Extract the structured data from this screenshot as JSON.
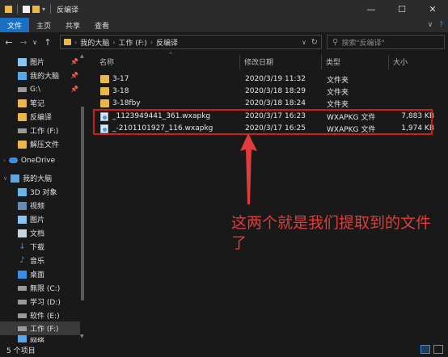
{
  "titlebar": {
    "title": "反编译",
    "minimize": "—",
    "maximize": "☐",
    "close": "✕"
  },
  "ribbon": {
    "tabs": [
      "文件",
      "主页",
      "共享",
      "查看"
    ],
    "expand": "∨",
    "help": "?"
  },
  "address": {
    "crumbs": [
      "我的大脑",
      "工作 (F:)",
      "反编译"
    ],
    "search_placeholder": "搜索\"反编译\""
  },
  "sidebar": {
    "items": [
      {
        "label": "图片",
        "icon": "pictures-icon",
        "pinned": true
      },
      {
        "label": "我的大脑",
        "icon": "computer-icon",
        "pinned": true
      },
      {
        "label": "G:\\",
        "icon": "drive-icon",
        "pinned": true
      },
      {
        "label": "笔记",
        "icon": "folder-icon",
        "pinned": false
      },
      {
        "label": "反编译",
        "icon": "folder-icon",
        "pinned": false
      },
      {
        "label": "工作 (F:)",
        "icon": "drive-icon",
        "pinned": false
      },
      {
        "label": "解压文件",
        "icon": "folder-icon",
        "pinned": false
      },
      {
        "label": "OneDrive",
        "icon": "cloud-icon",
        "pinned": false
      },
      {
        "label": "我的大脑",
        "icon": "computer-icon",
        "pinned": false
      },
      {
        "label": "3D 对象",
        "icon": "3d-objects-icon",
        "pinned": false
      },
      {
        "label": "视频",
        "icon": "video-icon",
        "pinned": false
      },
      {
        "label": "图片",
        "icon": "pictures-icon",
        "pinned": false
      },
      {
        "label": "文档",
        "icon": "documents-icon",
        "pinned": false
      },
      {
        "label": "下载",
        "icon": "download-icon",
        "pinned": false
      },
      {
        "label": "音乐",
        "icon": "music-icon",
        "pinned": false
      },
      {
        "label": "桌面",
        "icon": "desktop-icon",
        "pinned": false
      },
      {
        "label": "無限 (C:)",
        "icon": "drive-icon",
        "pinned": false
      },
      {
        "label": "学习 (D:)",
        "icon": "drive-icon",
        "pinned": false
      },
      {
        "label": "软件 (E:)",
        "icon": "drive-icon",
        "pinned": false
      },
      {
        "label": "工作 (F:)",
        "icon": "drive-icon",
        "pinned": false
      },
      {
        "label": "网络",
        "icon": "network-icon",
        "pinned": false
      }
    ]
  },
  "columns": {
    "name": "名称",
    "date": "修改日期",
    "type": "类型",
    "size": "大小"
  },
  "files": [
    {
      "name": "3-17",
      "date": "2020/3/19 11:32",
      "type": "文件夹",
      "size": "",
      "kind": "folder"
    },
    {
      "name": "3-18",
      "date": "2020/3/18 18:29",
      "type": "文件夹",
      "size": "",
      "kind": "folder"
    },
    {
      "name": "3-18fby",
      "date": "2020/3/18 18:24",
      "type": "文件夹",
      "size": "",
      "kind": "folder"
    },
    {
      "name": "_1123949441_361.wxapkg",
      "date": "2020/3/17 16:23",
      "type": "WXAPKG 文件",
      "size": "7,883 KB",
      "kind": "wxapkg"
    },
    {
      "name": "_-2101101927_116.wxapkg",
      "date": "2020/3/17 16:25",
      "type": "WXAPKG 文件",
      "size": "1,974 KB",
      "kind": "wxapkg"
    }
  ],
  "annotation": {
    "text": "这两个就是我们提取到的文件了"
  },
  "statusbar": {
    "count": "5 个项目"
  },
  "colors": {
    "accent": "#1a6fc2",
    "annotation_red": "#e23b3b",
    "highlight_red": "#d21b1b",
    "folder_yellow": "#e8b84a"
  }
}
